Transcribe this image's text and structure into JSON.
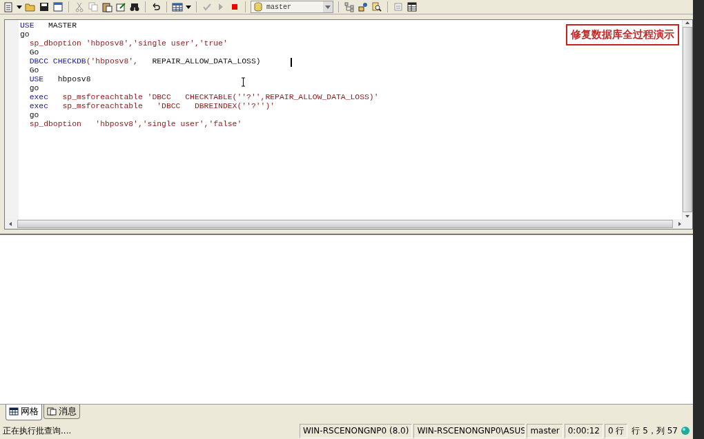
{
  "toolbar": {
    "database": "master"
  },
  "editor": {
    "overlay_caption": "修复数据库全过程演示",
    "lines": [
      {
        "tokens": [
          {
            "kind": "kw",
            "text": "USE"
          },
          {
            "kind": "plain",
            "text": "   MASTER"
          }
        ]
      },
      {
        "tokens": [
          {
            "kind": "plain",
            "text": "go"
          }
        ]
      },
      {
        "tokens": [
          {
            "kind": "str",
            "text": "  sp_dboption 'hbposv8','single user','true'"
          }
        ]
      },
      {
        "tokens": [
          {
            "kind": "plain",
            "text": "  Go"
          }
        ]
      },
      {
        "tokens": [
          {
            "kind": "kw",
            "text": "  DBCC CHECKDB"
          },
          {
            "kind": "str",
            "text": "('hbposv8',"
          },
          {
            "kind": "plain",
            "text": "   REPAIR_ALLOW_DATA_LOSS)"
          }
        ]
      },
      {
        "tokens": [
          {
            "kind": "plain",
            "text": "  Go"
          }
        ]
      },
      {
        "tokens": [
          {
            "kind": "kw",
            "text": "  USE"
          },
          {
            "kind": "plain",
            "text": "   hbposv8"
          }
        ]
      },
      {
        "tokens": [
          {
            "kind": "plain",
            "text": "  go"
          }
        ]
      },
      {
        "tokens": [
          {
            "kind": "kw",
            "text": "  exec"
          },
          {
            "kind": "str",
            "text": "   sp_msforeachtable 'DBCC   CHECKTABLE(''?'',REPAIR_ALLOW_DATA_LOSS)'"
          }
        ]
      },
      {
        "tokens": [
          {
            "kind": "kw",
            "text": "  exec"
          },
          {
            "kind": "str",
            "text": "   sp_msforeachtable   'DBCC   DBREINDEX(''?'')'"
          }
        ]
      },
      {
        "tokens": [
          {
            "kind": "plain",
            "text": "  go"
          }
        ]
      },
      {
        "tokens": [
          {
            "kind": "str",
            "text": "  sp_dboption   'hbposv8','single user','false'"
          }
        ]
      }
    ]
  },
  "result_tabs": [
    {
      "label": "网格",
      "selected": true
    },
    {
      "label": "消息",
      "selected": false
    }
  ],
  "status_bar": {
    "message": "正在执行批查询....",
    "server": "WIN-RSCENONGNP0 (8.0)",
    "user": "WIN-RSCENONGNP0\\ASUS",
    "database": "master",
    "elapsed": "0:00:12",
    "rows": "0 行",
    "position": "行 5，列 57"
  }
}
